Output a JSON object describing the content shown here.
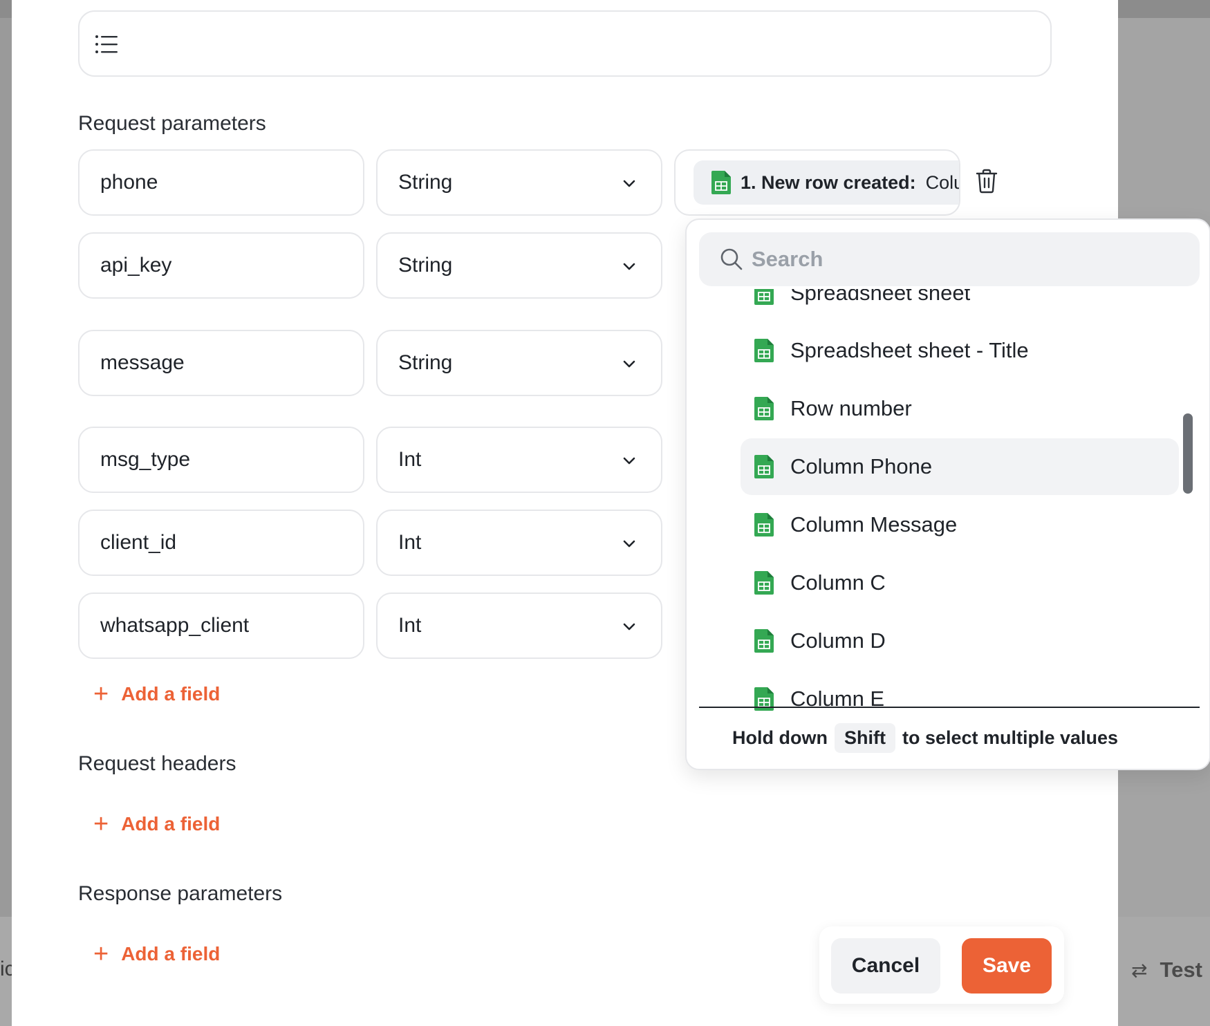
{
  "background": {
    "left_fragment": "ic",
    "test_label": "Test"
  },
  "sections": {
    "request_parameters": "Request parameters",
    "request_headers": "Request headers",
    "response_parameters": "Response parameters"
  },
  "params": [
    {
      "name": "phone",
      "type": "String"
    },
    {
      "name": "api_key",
      "type": "String"
    },
    {
      "name": "message",
      "type": "String"
    },
    {
      "name": "msg_type",
      "type": "Int"
    },
    {
      "name": "client_id",
      "type": "Int"
    },
    {
      "name": "whatsapp_client",
      "type": "Int"
    }
  ],
  "value_chip": {
    "label": "1. New row created:",
    "value": "Column Phone"
  },
  "add_field_label": "Add a field",
  "dropdown": {
    "search_placeholder": "Search",
    "options": [
      "Spreadsheet sheet",
      "Spreadsheet sheet - Title",
      "Row number",
      "Column Phone",
      "Column Message",
      "Column C",
      "Column D",
      "Column E"
    ],
    "selected": "Column Phone",
    "hint": {
      "prefix": "Hold down",
      "key": "Shift",
      "suffix": "to select multiple values"
    }
  },
  "actions": {
    "cancel": "Cancel",
    "save": "Save"
  },
  "colors": {
    "accent": "#ec6236",
    "sheet_green": "#34a853",
    "border": "#e6e7ea"
  }
}
